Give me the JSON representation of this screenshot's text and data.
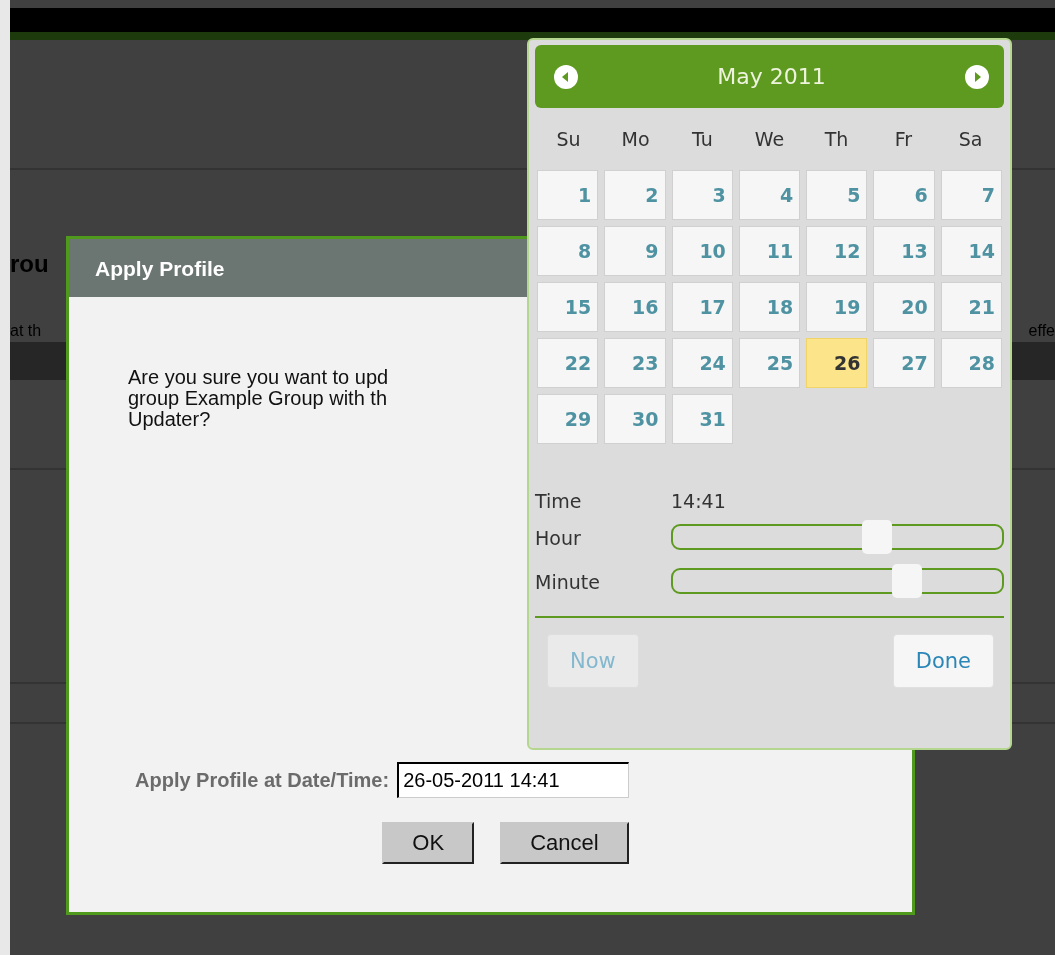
{
  "background": {
    "heading": "rou",
    "left_text": "at th",
    "right_text": "effe"
  },
  "dialog": {
    "title": "Apply Profile",
    "message_lines": [
      "Are you sure you want to upd",
      "group Example Group with th",
      "Updater?"
    ],
    "date_label": "Apply Profile at Date/Time:",
    "date_value": "26-05-2011 14:41",
    "buttons": [
      {
        "label": "OK"
      },
      {
        "label": "Cancel"
      }
    ]
  },
  "datepicker": {
    "title": "May 2011",
    "weekdays": [
      "Su",
      "Mo",
      "Tu",
      "We",
      "Th",
      "Fr",
      "Sa"
    ],
    "days": [
      {
        "label": "1",
        "selected": false
      },
      {
        "label": "2",
        "selected": false
      },
      {
        "label": "3",
        "selected": false
      },
      {
        "label": "4",
        "selected": false
      },
      {
        "label": "5",
        "selected": false
      },
      {
        "label": "6",
        "selected": false
      },
      {
        "label": "7",
        "selected": false
      },
      {
        "label": "8",
        "selected": false
      },
      {
        "label": "9",
        "selected": false
      },
      {
        "label": "10",
        "selected": false
      },
      {
        "label": "11",
        "selected": false
      },
      {
        "label": "12",
        "selected": false
      },
      {
        "label": "13",
        "selected": false
      },
      {
        "label": "14",
        "selected": false
      },
      {
        "label": "15",
        "selected": false
      },
      {
        "label": "16",
        "selected": false
      },
      {
        "label": "17",
        "selected": false
      },
      {
        "label": "18",
        "selected": false
      },
      {
        "label": "19",
        "selected": false
      },
      {
        "label": "20",
        "selected": false
      },
      {
        "label": "21",
        "selected": false
      },
      {
        "label": "22",
        "selected": false
      },
      {
        "label": "23",
        "selected": false
      },
      {
        "label": "24",
        "selected": false
      },
      {
        "label": "25",
        "selected": false
      },
      {
        "label": "26",
        "selected": true
      },
      {
        "label": "27",
        "selected": false
      },
      {
        "label": "28",
        "selected": false
      },
      {
        "label": "29",
        "selected": false
      },
      {
        "label": "30",
        "selected": false
      },
      {
        "label": "31",
        "selected": false
      }
    ],
    "time_label": "Time",
    "time_value": "14:41",
    "sliders": [
      {
        "label": "Hour",
        "level": 0.63
      },
      {
        "label": "Minute",
        "level": 0.73
      }
    ],
    "buttons": [
      {
        "label": "Now",
        "disabled": true
      },
      {
        "label": "Done",
        "disabled": false
      }
    ]
  }
}
